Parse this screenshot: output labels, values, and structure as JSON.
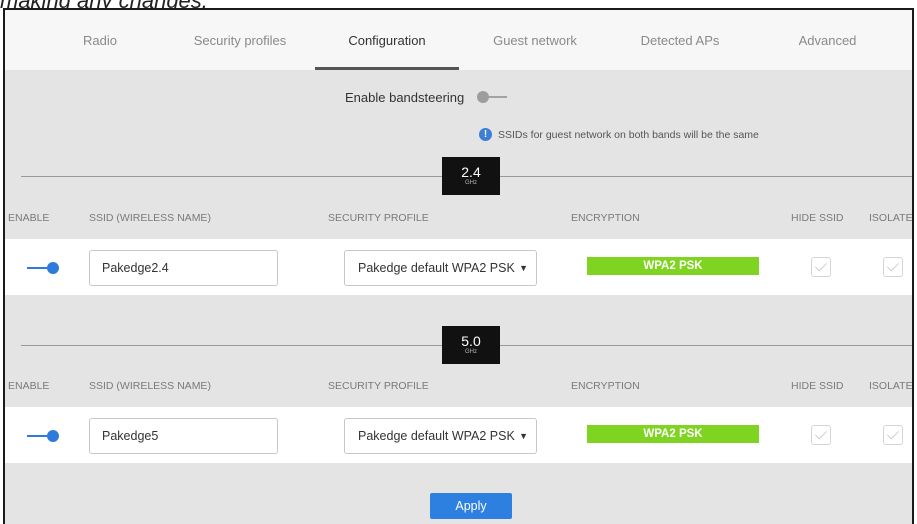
{
  "top_caption": "making any changes.",
  "tabs": [
    {
      "label": "Radio",
      "active": false
    },
    {
      "label": "Security profiles",
      "active": false
    },
    {
      "label": "Configuration",
      "active": true
    },
    {
      "label": "Guest network",
      "active": false
    },
    {
      "label": "Detected APs",
      "active": false
    },
    {
      "label": "Advanced",
      "active": false
    }
  ],
  "bandsteering": {
    "label": "Enable bandsteering",
    "enabled": false
  },
  "info_text": "SSIDs for guest network on both bands will be the same",
  "columns": {
    "enable": "ENABLE",
    "ssid": "SSID (WIRELESS NAME)",
    "security_profile": "SECURITY PROFILE",
    "encryption": "ENCRYPTION",
    "hide_ssid": "HIDE SSID",
    "isolate": "ISOLATE"
  },
  "bands": [
    {
      "band": "2.4",
      "unit": "GHz",
      "row": {
        "enabled": true,
        "ssid": "Pakedge2.4",
        "security_profile": "Pakedge default WPA2 PSK",
        "encryption": "WPA2 PSK",
        "hide_ssid": false,
        "isolate": false
      }
    },
    {
      "band": "5.0",
      "unit": "GHz",
      "row": {
        "enabled": true,
        "ssid": "Pakedge5",
        "security_profile": "Pakedge default WPA2 PSK",
        "encryption": "WPA2 PSK",
        "hide_ssid": false,
        "isolate": false
      }
    }
  ],
  "apply_label": "Apply",
  "colors": {
    "accent": "#2d7fe0",
    "encryption_badge": "#7fd321",
    "info_icon": "#3d7fd6"
  }
}
